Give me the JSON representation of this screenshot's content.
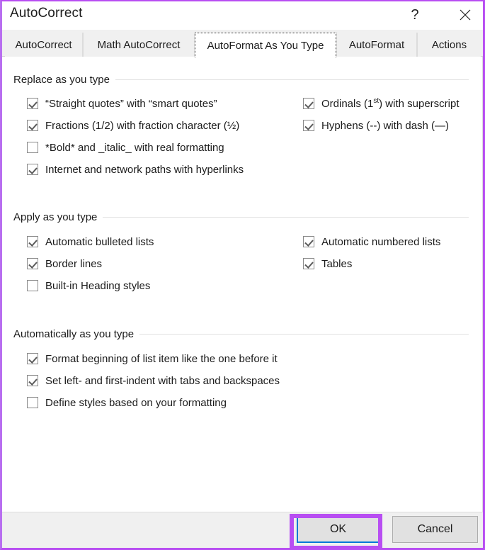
{
  "window": {
    "title": "AutoCorrect",
    "help_icon": "question-mark-icon",
    "close_icon": "close-icon",
    "border_color": "#b84ef2"
  },
  "tabs": [
    {
      "label": "AutoCorrect",
      "active": false
    },
    {
      "label": "Math AutoCorrect",
      "active": false
    },
    {
      "label": "AutoFormat As You Type",
      "active": true
    },
    {
      "label": "AutoFormat",
      "active": false
    },
    {
      "label": "Actions",
      "active": false
    }
  ],
  "groups": [
    {
      "title": "Replace as you type",
      "left_options": [
        {
          "label": "“Straight quotes” with “smart quotes”",
          "checked": true
        },
        {
          "label": "Fractions (1/2) with fraction character (½)",
          "checked": true
        },
        {
          "label": "*Bold* and _italic_ with real formatting",
          "checked": false
        },
        {
          "label": "Internet and network paths with hyperlinks",
          "checked": true
        }
      ],
      "right_options": [
        {
          "label": "Ordinals (1st) with superscript",
          "checked": true,
          "superscript": "st",
          "prefix": "Ordinals (1",
          "suffix": ") with superscript"
        },
        {
          "label": "Hyphens (--) with dash (—)",
          "checked": true
        }
      ]
    },
    {
      "title": "Apply as you type",
      "left_options": [
        {
          "label": "Automatic bulleted lists",
          "checked": true
        },
        {
          "label": "Border lines",
          "checked": true
        },
        {
          "label": "Built-in Heading styles",
          "checked": false
        }
      ],
      "right_options": [
        {
          "label": "Automatic numbered lists",
          "checked": true
        },
        {
          "label": "Tables",
          "checked": true
        }
      ]
    },
    {
      "title": "Automatically as you type",
      "left_options": [
        {
          "label": "Format beginning of list item like the one before it",
          "checked": true
        },
        {
          "label": "Set left- and first-indent with tabs and backspaces",
          "checked": true
        },
        {
          "label": "Define styles based on your formatting",
          "checked": false
        }
      ],
      "right_options": []
    }
  ],
  "footer": {
    "ok_label": "OK",
    "cancel_label": "Cancel",
    "ok_highlight_color": "#b84ef2",
    "ok_default_border_color": "#0078d7"
  }
}
